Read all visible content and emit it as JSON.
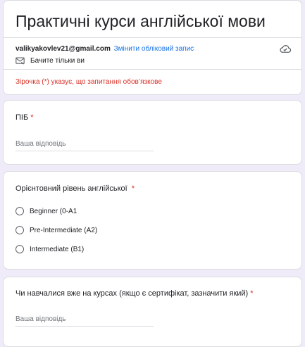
{
  "header": {
    "title": "Практичні курси англійської мови",
    "email": "valikyakovlev21@gmail.com",
    "switch_account": "Змінити обліковий запис",
    "visibility_note": "Бачите тільки ви",
    "required_note": "Зірочка (*) указує, що запитання обов’язкове"
  },
  "questions": [
    {
      "title": "ПІБ",
      "required_mark": "*",
      "placeholder": "Ваша відповідь"
    },
    {
      "title": "Орієнтовний рівень англійської",
      "required_mark": "*",
      "options": [
        "Beginner (0-A1",
        "Pre-Intermediate (A2)",
        "Intermediate (B1)"
      ]
    },
    {
      "title": "Чи навчалися вже на курсах (якщо є сертифікат, зазначити який)",
      "required_mark": "*",
      "placeholder": "Ваша відповідь"
    }
  ],
  "colors": {
    "background": "#f0ebf8",
    "link": "#1a73e8",
    "required": "#d93025"
  },
  "icons": [
    "cloud-saved-icon",
    "not-shared-icon"
  ]
}
